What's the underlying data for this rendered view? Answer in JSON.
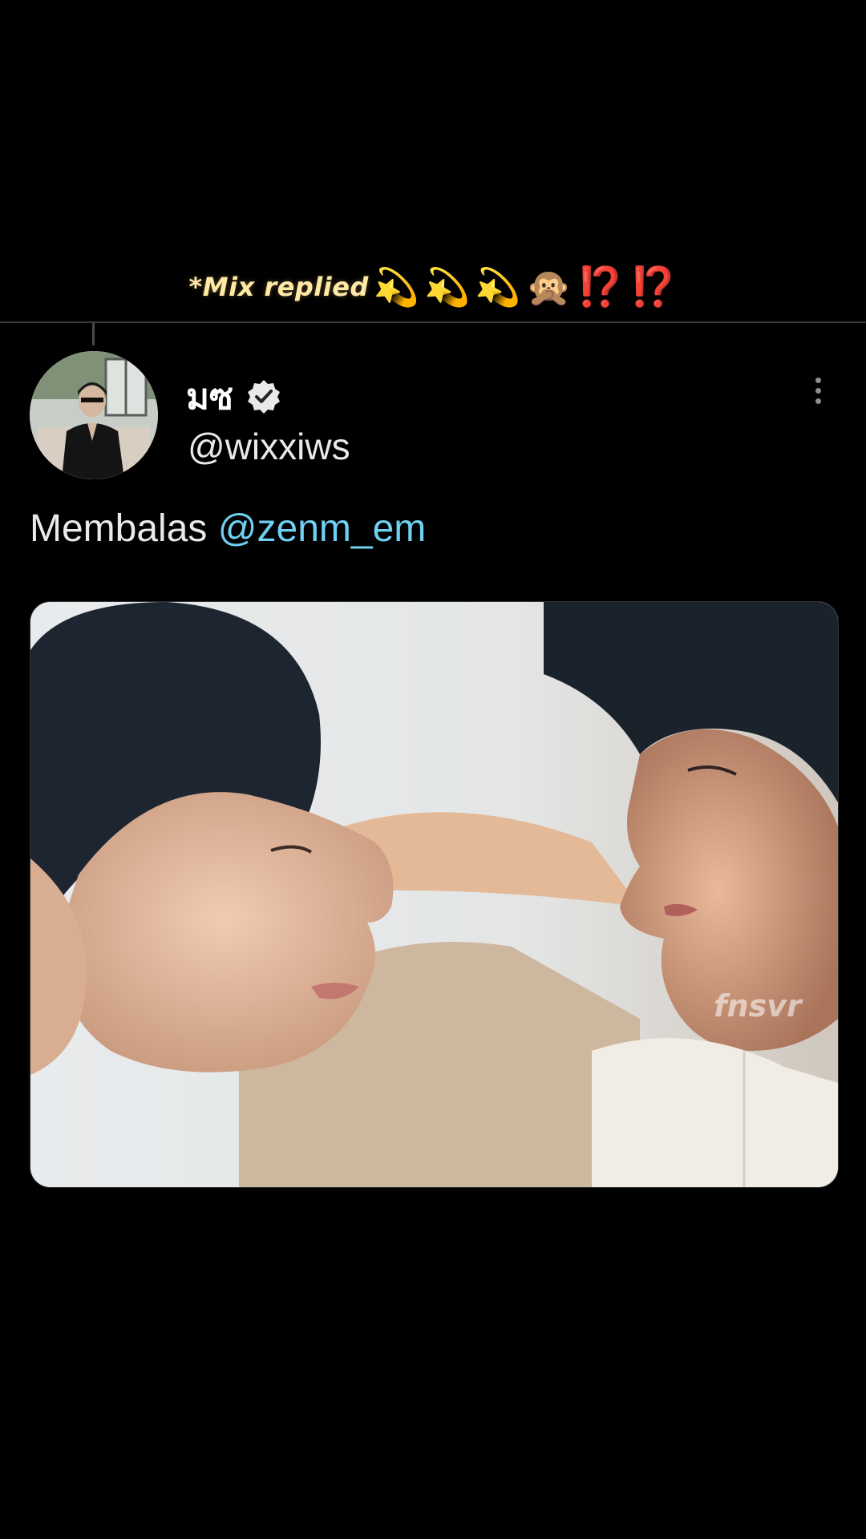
{
  "caption": {
    "text": "*Mix replied",
    "emoji": [
      {
        "glyph": "💫",
        "kind": "dizzy"
      },
      {
        "glyph": "💫",
        "kind": "dizzy"
      },
      {
        "glyph": "💫",
        "kind": "dizzy"
      },
      {
        "glyph": "🙊",
        "kind": "monkey"
      },
      {
        "glyph": "⁉️",
        "kind": "bang"
      },
      {
        "glyph": "⁉️",
        "kind": "bang"
      }
    ]
  },
  "tweet": {
    "display_name": "มซ",
    "verified_icon": "verified-badge-icon",
    "handle": "@wixxiws",
    "reply_prefix": "Membalas",
    "reply_mention": "@zenm_em",
    "more_icon": "more-vertical-icon",
    "media_watermark": "fnsvr"
  },
  "colors": {
    "background": "#000000",
    "mention": "#6fd0f2",
    "caption": "#ffe9a6",
    "divider": "#3a3a3a"
  }
}
